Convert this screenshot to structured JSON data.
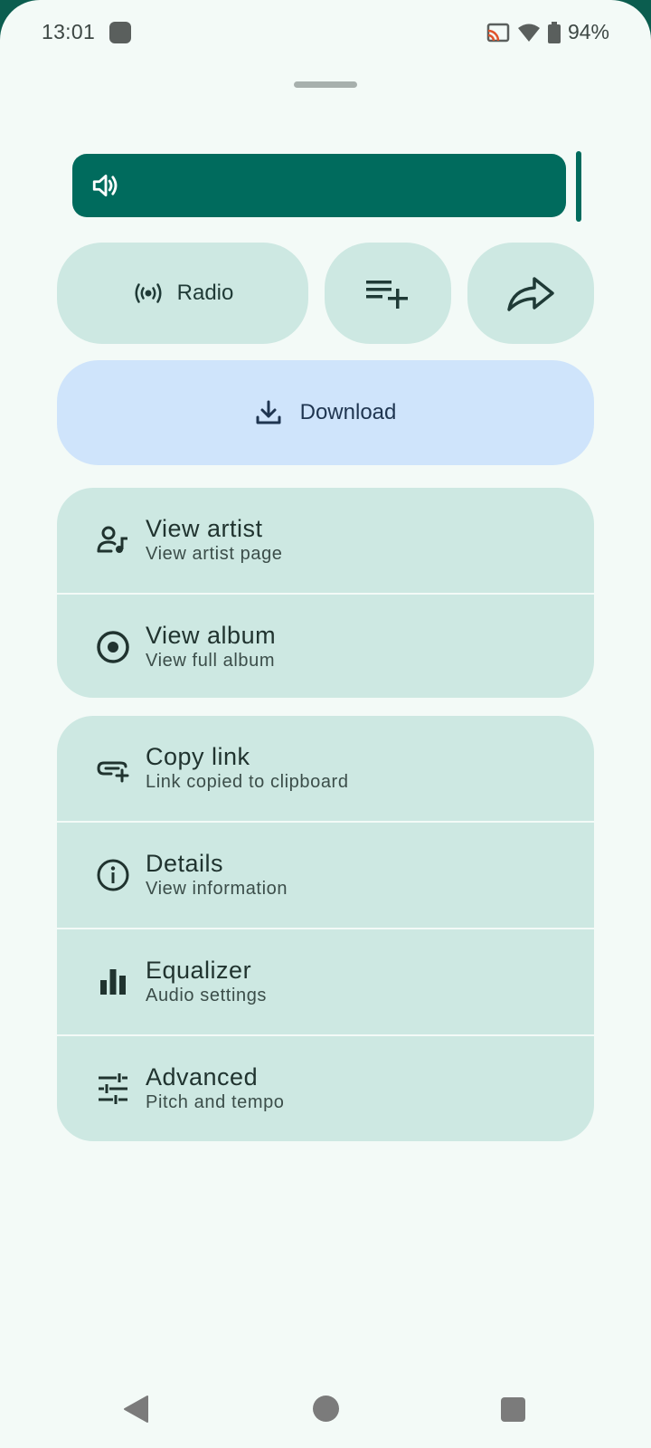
{
  "status_bar": {
    "time": "13:01",
    "battery": "94%",
    "icons": [
      "app-notification-icon",
      "cast-icon",
      "wifi-icon",
      "battery-icon"
    ]
  },
  "volume": {
    "icon": "volume-up-icon",
    "level": 1.0
  },
  "actions": {
    "radio_label": "Radio",
    "radio_icon": "radio-broadcast-icon",
    "queue_icon": "playlist-add-icon",
    "share_icon": "share-icon",
    "download_label": "Download",
    "download_icon": "download-icon"
  },
  "menu_group_1": [
    {
      "title": "View artist",
      "subtitle": "View artist page",
      "icon": "artist-icon"
    },
    {
      "title": "View album",
      "subtitle": "View full album",
      "icon": "album-icon"
    }
  ],
  "menu_group_2": [
    {
      "title": "Copy link",
      "subtitle": "Link copied to clipboard",
      "icon": "add-link-icon"
    },
    {
      "title": "Details",
      "subtitle": "View information",
      "icon": "info-icon"
    },
    {
      "title": "Equalizer",
      "subtitle": "Audio settings",
      "icon": "equalizer-icon"
    },
    {
      "title": "Advanced",
      "subtitle": "Pitch and tempo",
      "icon": "tune-icon"
    }
  ],
  "colors": {
    "primary": "#006b5d",
    "container": "#cde8e2",
    "download_container": "#cfe4fb",
    "background": "#f3faf7"
  }
}
